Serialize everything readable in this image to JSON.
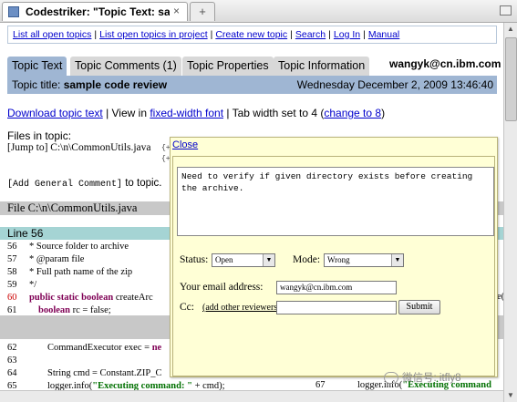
{
  "browser": {
    "tab_title": "Codestriker: \"Topic Text: sample ...",
    "tab_close": "×",
    "new_tab": "+"
  },
  "nav": {
    "links": [
      "List all open topics",
      "List open topics in project",
      "Create new topic",
      "Search",
      "Log In",
      "Manual"
    ],
    "separator": "|"
  },
  "tabs": [
    {
      "label": "Topic Text",
      "active": true
    },
    {
      "label": "Topic Comments (1)",
      "active": false
    },
    {
      "label": "Topic Properties",
      "active": false
    },
    {
      "label": "Topic Information",
      "active": false
    }
  ],
  "user_email": "wangyk@cn.ibm.com",
  "topic": {
    "title_label": "Topic title: ",
    "title": "sample code review",
    "date": "Wednesday December 2, 2009 13:46:40"
  },
  "options": {
    "download_link": "Download topic text",
    "view_prefix": " | View in ",
    "fixed_width_link": "fixed-width font",
    "tab_text": " | Tab width set to 4 (",
    "change_link": "change to 8",
    "tab_suffix": ")"
  },
  "files": {
    "label": "Files in topic:",
    "jump_bracket": "[Jump to]",
    "path": "C:\\n\\CommonUtils.java",
    "tree_marks": [
      "{+",
      "{+"
    ],
    "add_comment_link": "[Add General Comment]",
    "add_comment_suffix": " to topic."
  },
  "file_header": "File C:\\n\\CommonUtils.java",
  "line_header": "Line 56",
  "code_lines": [
    {
      "num": "56",
      "text": " *         Source folder to archive",
      "highlight": false
    },
    {
      "num": "57",
      "text": " * @param file",
      "highlight": false
    },
    {
      "num": "58",
      "text": " *         Full path name of the zip",
      "highlight": false
    },
    {
      "num": "59",
      "text": " */",
      "highlight": false
    },
    {
      "num": "60",
      "kw": "public static boolean",
      "text": " createArc",
      "highlight": true
    },
    {
      "num": "61",
      "kw": "boolean",
      "text": " rc = false;",
      "highlight": false,
      "indent": true
    },
    {
      "num": "62",
      "text": "CommandExecutor exec = ",
      "kw_after": "ne",
      "highlight": false,
      "indent2": true
    },
    {
      "num": "63",
      "text": "",
      "highlight": false
    },
    {
      "num": "64",
      "text": "String cmd = Constant.ZIP_C",
      "highlight": false,
      "indent2": true
    },
    {
      "num": "65",
      "text": "logger.info(",
      "green": "\"Executing command: \"",
      "after": " + cmd);",
      "highlight": false,
      "indent2": true
    }
  ],
  "right_side": {
    "num_67": "67",
    "cut_text_prefix": "logger.info(",
    "cut_green": "\"Executing command",
    "cut_e": "e("
  },
  "popup": {
    "close_label": "Close",
    "comment_text": "Need to verify if given directory exists before creating the archive.",
    "status_label": "Status:",
    "status_value": "Open",
    "mode_label": "Mode:",
    "mode_value": "Wrong",
    "email_label": "Your email address:",
    "email_value": "wangyk@cn.ibm.com",
    "cc_label": "Cc:",
    "cc_link": "(add other reviewers)",
    "cc_value": "",
    "submit_label": "Submit"
  },
  "watermark": "微信号: itfly8"
}
